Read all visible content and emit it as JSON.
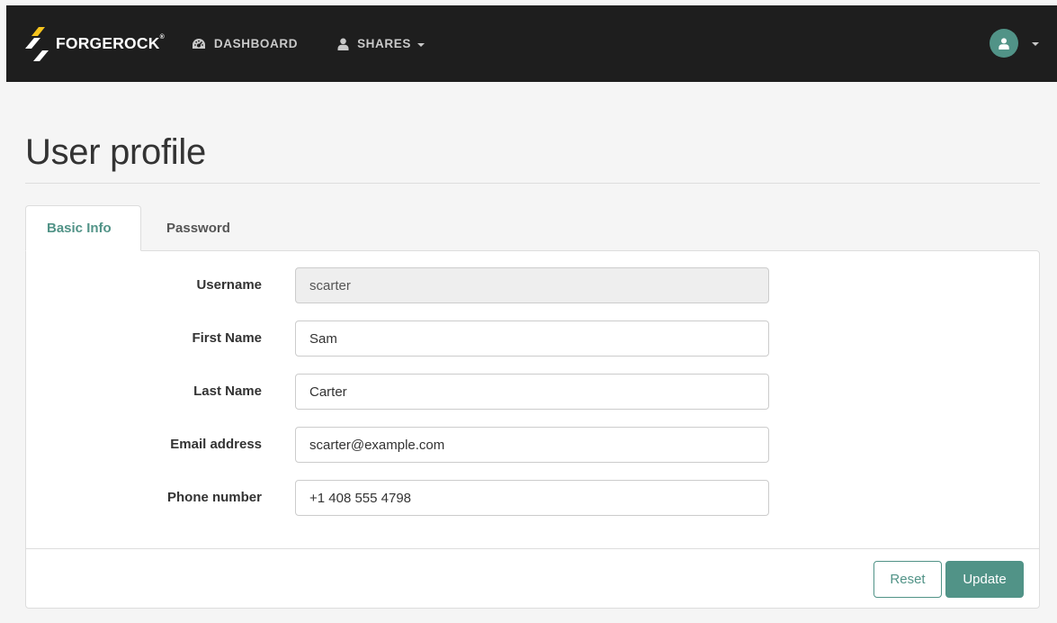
{
  "navbar": {
    "brand": "FORGEROCK",
    "brand_mark": "®",
    "items": [
      {
        "label": "DASHBOARD",
        "icon": "dashboard-icon"
      },
      {
        "label": "SHARES",
        "icon": "user-icon",
        "has_dropdown": true
      }
    ],
    "user_menu": {
      "icon": "user-avatar-icon",
      "has_dropdown": true
    }
  },
  "page": {
    "title": "User profile"
  },
  "tabs": [
    {
      "label": "Basic Info",
      "active": true
    },
    {
      "label": "Password",
      "active": false
    }
  ],
  "form": {
    "fields": [
      {
        "label": "Username",
        "value": "scarter",
        "readonly": true
      },
      {
        "label": "First Name",
        "value": "Sam",
        "readonly": false
      },
      {
        "label": "Last Name",
        "value": "Carter",
        "readonly": false
      },
      {
        "label": "Email address",
        "value": "scarter@example.com",
        "readonly": false
      },
      {
        "label": "Phone number",
        "value": "+1 408 555 4798",
        "readonly": false
      }
    ]
  },
  "actions": {
    "reset_label": "Reset",
    "update_label": "Update"
  },
  "colors": {
    "accent": "#519387",
    "navbar_bg": "#1e1e1e",
    "logo_yellow": "#f6c41d",
    "page_bg": "#f5f5f5"
  }
}
